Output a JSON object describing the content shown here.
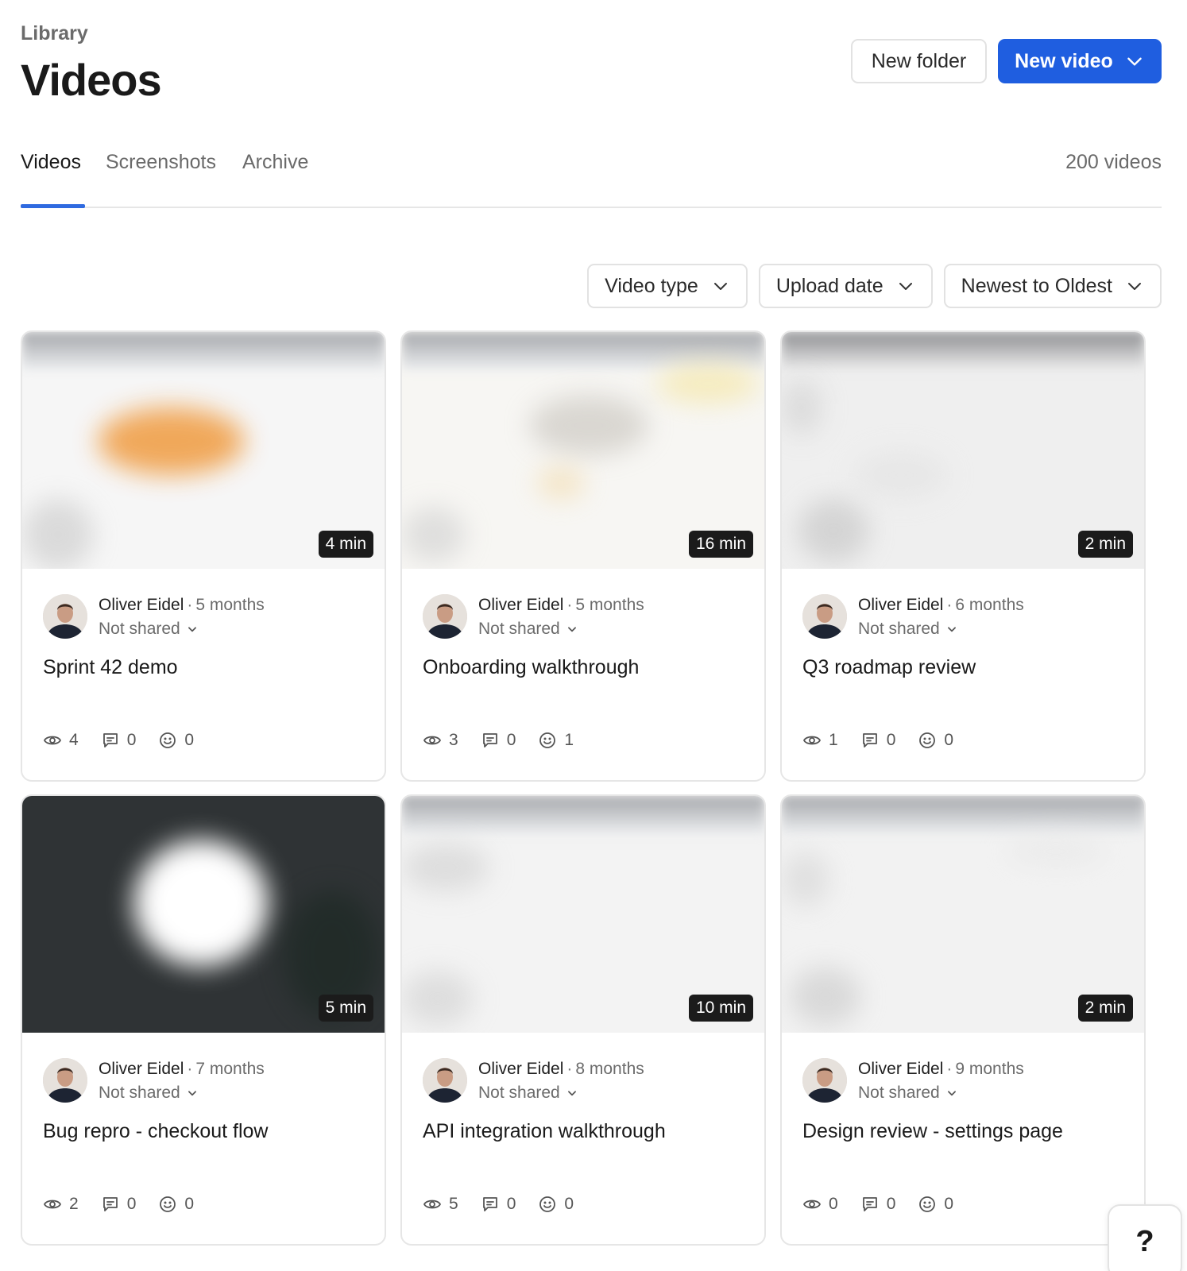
{
  "header": {
    "breadcrumb": "Library",
    "title": "Videos",
    "new_folder_label": "New folder",
    "new_video_label": "New video"
  },
  "tabs": [
    {
      "label": "Videos",
      "active": true
    },
    {
      "label": "Screenshots",
      "active": false
    },
    {
      "label": "Archive",
      "active": false
    }
  ],
  "video_count": "200 videos",
  "filters": {
    "video_type": "Video type",
    "upload_date": "Upload date",
    "sort": "Newest to Oldest"
  },
  "videos": [
    {
      "title": "Sprint 42 demo",
      "author": "Oliver Eidel",
      "age": "5 months",
      "sharing": "Not shared",
      "duration": "4 min",
      "views": "4",
      "comments": "0",
      "reactions": "0"
    },
    {
      "title": "Onboarding walkthrough",
      "author": "Oliver Eidel",
      "age": "5 months",
      "sharing": "Not shared",
      "duration": "16 min",
      "views": "3",
      "comments": "0",
      "reactions": "1"
    },
    {
      "title": "Q3 roadmap review",
      "author": "Oliver Eidel",
      "age": "6 months",
      "sharing": "Not shared",
      "duration": "2 min",
      "views": "1",
      "comments": "0",
      "reactions": "0"
    },
    {
      "title": "Bug repro - checkout flow",
      "author": "Oliver Eidel",
      "age": "7 months",
      "sharing": "Not shared",
      "duration": "5 min",
      "views": "2",
      "comments": "0",
      "reactions": "0"
    },
    {
      "title": "API integration walkthrough",
      "author": "Oliver Eidel",
      "age": "8 months",
      "sharing": "Not shared",
      "duration": "10 min",
      "views": "5",
      "comments": "0",
      "reactions": "0"
    },
    {
      "title": "Design review - settings page",
      "author": "Oliver Eidel",
      "age": "9 months",
      "sharing": "Not shared",
      "duration": "2 min",
      "views": "0",
      "comments": "0",
      "reactions": "0"
    }
  ],
  "help_label": "?",
  "colors": {
    "accent": "#1f5ee0",
    "tab_underline": "#2f6ae0"
  }
}
